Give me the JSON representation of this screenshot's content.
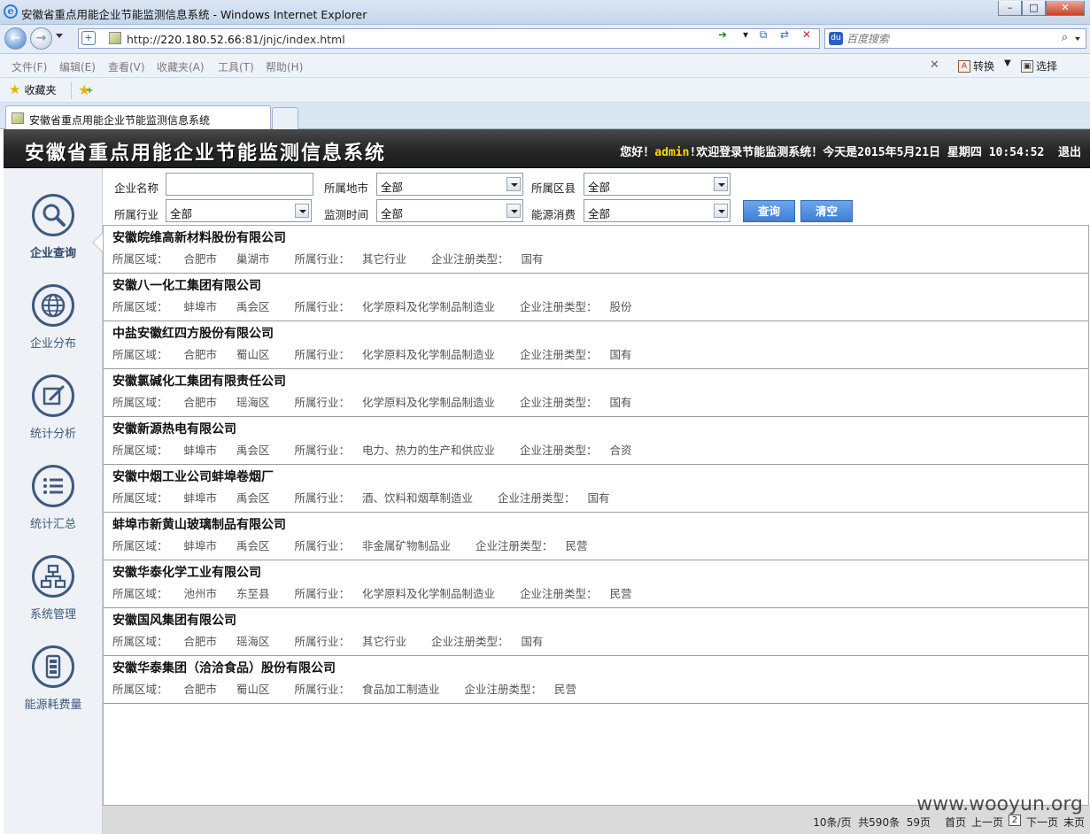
{
  "window": {
    "title": "安徽省重点用能企业节能监测信息系统 - Windows Internet Explorer",
    "min": "–",
    "max": "□",
    "close": "✕"
  },
  "address": {
    "url_prefix": "http://",
    "url_host": "220.180.52.66",
    "url_rest": ":81/jnjc/index.html",
    "search_placeholder": "百度搜索"
  },
  "menu": {
    "items": [
      "文件(F)",
      "编辑(E)",
      "查看(V)",
      "收藏夹(A)",
      "工具(T)",
      "帮助(H)"
    ],
    "close": "✕",
    "convert": "转换",
    "select": "选择"
  },
  "favorites": {
    "label": "收藏夹"
  },
  "tab": {
    "label": "安徽省重点用能企业节能监测信息系统"
  },
  "header": {
    "title": "安徽省重点用能企业节能监测信息系统",
    "greet_prefix": "您好！",
    "user": "admin",
    "greet_suffix": "!欢迎登录节能监测系统！今天是2015年5月21日 星期四 10:54:52",
    "logout": "退出"
  },
  "sidebar": {
    "items": [
      {
        "label": "企业查询",
        "icon": "magnifier-icon"
      },
      {
        "label": "企业分布",
        "icon": "globe-icon"
      },
      {
        "label": "统计分析",
        "icon": "edit-icon"
      },
      {
        "label": "统计汇总",
        "icon": "list-icon"
      },
      {
        "label": "系统管理",
        "icon": "org-chart-icon"
      },
      {
        "label": "能源耗费量",
        "icon": "meter-icon"
      }
    ]
  },
  "filters": {
    "company_name_label": "企业名称",
    "company_name_value": "",
    "city_label": "所属地市",
    "city_value": "全部",
    "county_label": "所属区县",
    "county_value": "全部",
    "industry_label": "所属行业",
    "industry_value": "全部",
    "time_label": "监测时间",
    "time_value": "全部",
    "energy_label": "能源消费",
    "energy_value": "全部",
    "query_button": "查询",
    "clear_button": "清空"
  },
  "meta_labels": {
    "region": "所属区域：",
    "industry": "所属行业：",
    "type": "企业注册类型："
  },
  "results": [
    {
      "name": "安徽皖维高新材料股份有限公司",
      "city": "合肥市",
      "district": "巢湖市",
      "industry": "其它行业",
      "type": "国有"
    },
    {
      "name": "安徽八一化工集团有限公司",
      "city": "蚌埠市",
      "district": "禹会区",
      "industry": "化学原料及化学制品制造业",
      "type": "股份"
    },
    {
      "name": "中盐安徽红四方股份有限公司",
      "city": "合肥市",
      "district": "蜀山区",
      "industry": "化学原料及化学制品制造业",
      "type": "国有"
    },
    {
      "name": "安徽氯碱化工集团有限责任公司",
      "city": "合肥市",
      "district": "瑶海区",
      "industry": "化学原料及化学制品制造业",
      "type": "国有"
    },
    {
      "name": "安徽新源热电有限公司",
      "city": "蚌埠市",
      "district": "禹会区",
      "industry": "电力、热力的生产和供应业",
      "type": "合资"
    },
    {
      "name": "安徽中烟工业公司蚌埠卷烟厂",
      "city": "蚌埠市",
      "district": "禹会区",
      "industry": "酒、饮料和烟草制造业",
      "type": "国有"
    },
    {
      "name": "蚌埠市新黄山玻璃制品有限公司",
      "city": "蚌埠市",
      "district": "禹会区",
      "industry": "非金属矿物制品业",
      "type": "民营"
    },
    {
      "name": "安徽华泰化学工业有限公司",
      "city": "池州市",
      "district": "东至县",
      "industry": "化学原料及化学制品制造业",
      "type": "民营"
    },
    {
      "name": "安徽国风集团有限公司",
      "city": "合肥市",
      "district": "瑶海区",
      "industry": "其它行业",
      "type": "国有"
    },
    {
      "name": "安徽华泰集团（洽洽食品）股份有限公司",
      "city": "合肥市",
      "district": "蜀山区",
      "industry": "食品加工制造业",
      "type": "民营"
    }
  ],
  "footer": {
    "per_page": "10条/页",
    "total": "共590条",
    "pages": "59页",
    "first": "首页",
    "prev": "上一页",
    "current_page": "2",
    "next": "下一页",
    "last": "末页"
  },
  "watermark": "www.wooyun.org"
}
